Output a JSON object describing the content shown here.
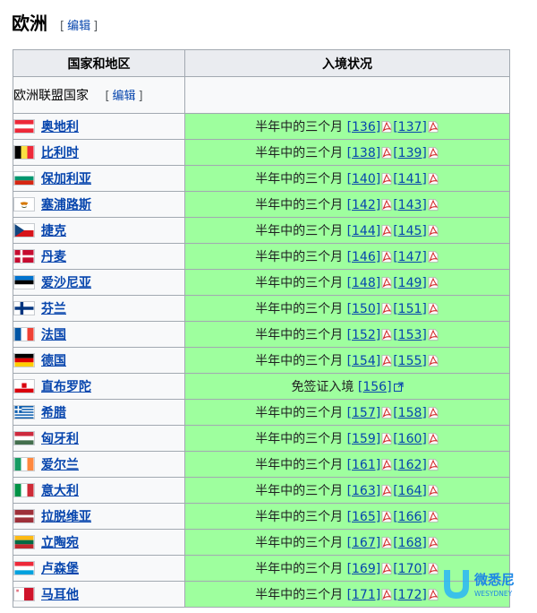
{
  "section": {
    "title": "欧洲",
    "edit_label": "编辑",
    "bracket_open": "[",
    "bracket_close": "]"
  },
  "table": {
    "headers": {
      "country": "国家和地区",
      "status": "入境状况"
    },
    "subheader": {
      "label": "欧洲联盟国家",
      "edit_label": "编辑"
    },
    "rows": [
      {
        "country": "奥地利",
        "status": "半年中的三个月",
        "refs": [
          "[136]",
          "[137]"
        ],
        "flag": "austria",
        "pdf": true
      },
      {
        "country": "比利时",
        "status": "半年中的三个月",
        "refs": [
          "[138]",
          "[139]"
        ],
        "flag": "belgium",
        "pdf": true
      },
      {
        "country": "保加利亚",
        "status": "半年中的三个月",
        "refs": [
          "[140]",
          "[141]"
        ],
        "flag": "bulgaria",
        "pdf": true
      },
      {
        "country": "塞浦路斯",
        "status": "半年中的三个月",
        "refs": [
          "[142]",
          "[143]"
        ],
        "flag": "cyprus",
        "pdf": true
      },
      {
        "country": "捷克",
        "status": "半年中的三个月",
        "refs": [
          "[144]",
          "[145]"
        ],
        "flag": "czech",
        "pdf": true
      },
      {
        "country": "丹麦",
        "status": "半年中的三个月",
        "refs": [
          "[146]",
          "[147]"
        ],
        "flag": "denmark",
        "pdf": true
      },
      {
        "country": "爱沙尼亚",
        "status": "半年中的三个月",
        "refs": [
          "[148]",
          "[149]"
        ],
        "flag": "estonia",
        "pdf": true
      },
      {
        "country": "芬兰",
        "status": "半年中的三个月",
        "refs": [
          "[150]",
          "[151]"
        ],
        "flag": "finland",
        "pdf": true
      },
      {
        "country": "法国",
        "status": "半年中的三个月",
        "refs": [
          "[152]",
          "[153]"
        ],
        "flag": "france",
        "pdf": true
      },
      {
        "country": "德国",
        "status": "半年中的三个月",
        "refs": [
          "[154]",
          "[155]"
        ],
        "flag": "germany",
        "pdf": true
      },
      {
        "country": "直布罗陀",
        "status": "免签证入境",
        "refs": [
          "[156]"
        ],
        "flag": "gibraltar",
        "pdf": false
      },
      {
        "country": "希腊",
        "status": "半年中的三个月",
        "refs": [
          "[157]",
          "[158]"
        ],
        "flag": "greece",
        "pdf": true
      },
      {
        "country": "匈牙利",
        "status": "半年中的三个月",
        "refs": [
          "[159]",
          "[160]"
        ],
        "flag": "hungary",
        "pdf": true
      },
      {
        "country": "爱尔兰",
        "status": "半年中的三个月",
        "refs": [
          "[161]",
          "[162]"
        ],
        "flag": "ireland",
        "pdf": true
      },
      {
        "country": "意大利",
        "status": "半年中的三个月",
        "refs": [
          "[163]",
          "[164]"
        ],
        "flag": "italy",
        "pdf": true
      },
      {
        "country": "拉脱维亚",
        "status": "半年中的三个月",
        "refs": [
          "[165]",
          "[166]"
        ],
        "flag": "latvia",
        "pdf": true
      },
      {
        "country": "立陶宛",
        "status": "半年中的三个月",
        "refs": [
          "[167]",
          "[168]"
        ],
        "flag": "lithuania",
        "pdf": true
      },
      {
        "country": "卢森堡",
        "status": "半年中的三个月",
        "refs": [
          "[169]",
          "[170]"
        ],
        "flag": "luxembourg",
        "pdf": true
      },
      {
        "country": "马耳他",
        "status": "半年中的三个月",
        "refs": [
          "[171]",
          "[172]"
        ],
        "flag": "malta",
        "pdf": true
      }
    ]
  },
  "watermark": {
    "line1": "微悉尼",
    "line2": "WESYDNEY",
    "accent": "#1e88e5"
  },
  "colors": {
    "status_green": "#9eff9e",
    "link": "#0645ad",
    "header_bg": "#eaecf0"
  }
}
